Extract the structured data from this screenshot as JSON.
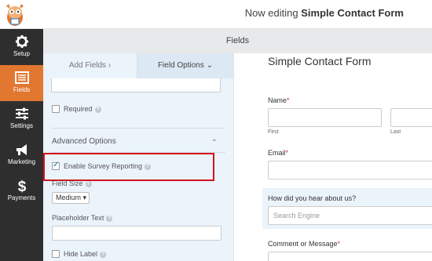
{
  "header": {
    "title_prefix": "Now editing",
    "title_form": "Simple Contact Form"
  },
  "sidebar": {
    "items": [
      {
        "label": "Setup",
        "icon": "gear-icon"
      },
      {
        "label": "Fields",
        "icon": "list-icon"
      },
      {
        "label": "Settings",
        "icon": "sliders-icon"
      },
      {
        "label": "Marketing",
        "icon": "megaphone-icon"
      },
      {
        "label": "Payments",
        "icon": "dollar-icon"
      }
    ],
    "active": "Fields"
  },
  "section_header": "Fields",
  "panel": {
    "tabs": {
      "add": "Add Fields",
      "add_glyph": "›",
      "options": "Field Options",
      "options_glyph": "⌄"
    },
    "help_glyph": "?",
    "required_label": "Required",
    "advanced_title": "Advanced Options",
    "advanced_glyph": "⌄",
    "survey_label": "Enable Survey Reporting",
    "field_size_label": "Field Size",
    "field_size_value": "Medium",
    "field_size_glyph": "▾",
    "placeholder_label": "Placeholder Text",
    "hide_label": "Hide Label"
  },
  "form": {
    "title": "Simple Contact Form",
    "required_mark": "*",
    "name_label": "Name",
    "first_sub": "First",
    "last_sub": "Last",
    "email_label": "Email",
    "hear_label": "How did you hear about us?",
    "hear_placeholder": "Search Engine",
    "comment_label": "Comment or Message"
  },
  "colors": {
    "accent": "#e27730",
    "sidebar": "#2e2e2e",
    "highlight": "#d2141d",
    "panel": "#ebf3fb"
  }
}
